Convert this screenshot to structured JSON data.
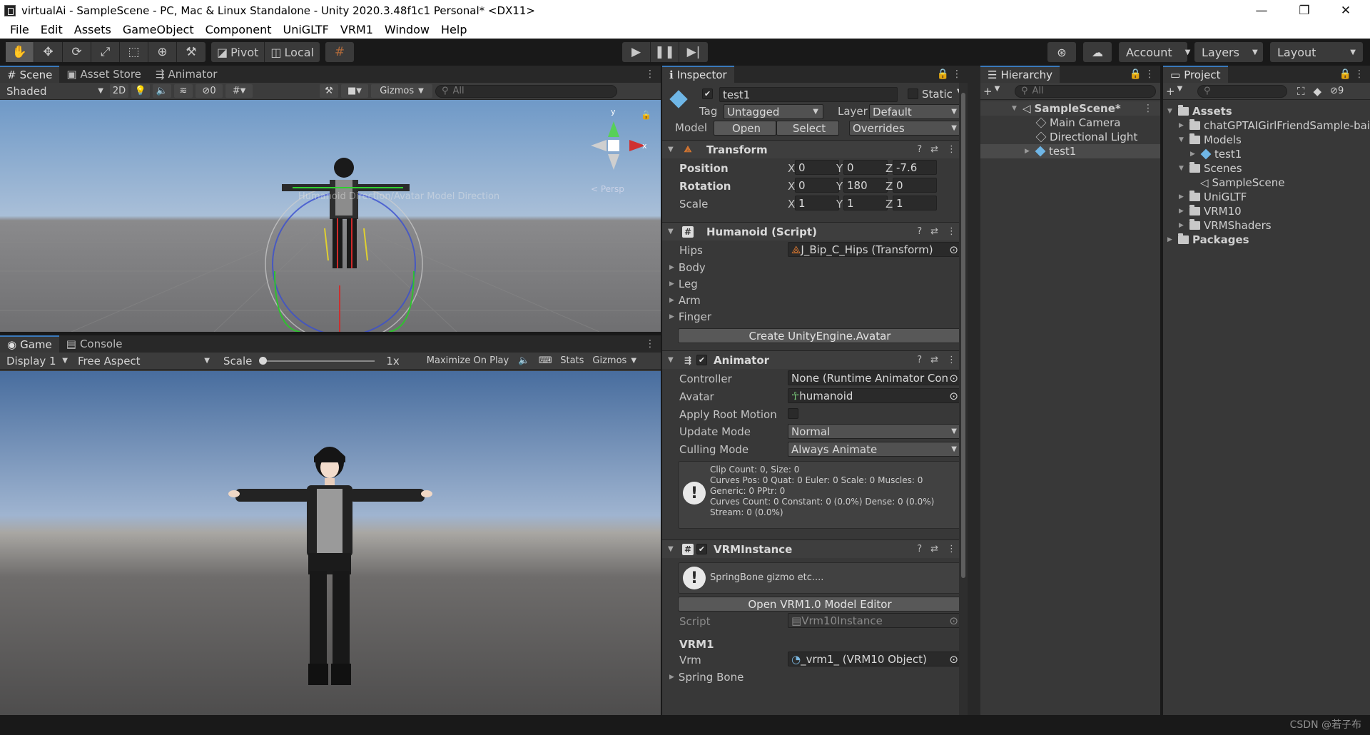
{
  "window": {
    "title": "virtualAi - SampleScene - PC, Mac & Linux Standalone - Unity 2020.3.48f1c1 Personal* <DX11>",
    "controls": [
      "—",
      "❐",
      "✕"
    ]
  },
  "menu": [
    "File",
    "Edit",
    "Assets",
    "GameObject",
    "Component",
    "UniGLTF",
    "VRM1",
    "Window",
    "Help"
  ],
  "toolbar": {
    "pivot": "Pivot",
    "local": "Local",
    "account": "Account",
    "layers": "Layers",
    "layout": "Layout"
  },
  "scene": {
    "tabs": [
      "Scene",
      "Asset Store",
      "Animator"
    ],
    "shading": "Shaded",
    "mode_2d": "2D",
    "hidden_count": "0",
    "gizmos": "Gizmos",
    "search_placeholder": "All",
    "persp": "< Persp",
    "overlay_text": "Humanoid Direction/Avatar Model Direction"
  },
  "game": {
    "tabs": [
      "Game",
      "Console"
    ],
    "display": "Display 1",
    "aspect": "Free Aspect",
    "scale_label": "Scale",
    "scale_value": "1x",
    "maximize": "Maximize On Play",
    "stats": "Stats",
    "gizmos": "Gizmos"
  },
  "inspector": {
    "tab": "Inspector",
    "object_name": "test1",
    "static_label": "Static",
    "tag_label": "Tag",
    "tag_value": "Untagged",
    "layer_label": "Layer",
    "layer_value": "Default",
    "model_label": "Model",
    "open_btn": "Open",
    "select_btn": "Select",
    "overrides": "Overrides",
    "transform": {
      "title": "Transform",
      "position_label": "Position",
      "rotation_label": "Rotation",
      "scale_label": "Scale",
      "position": {
        "x": "0",
        "y": "0",
        "z": "-7.6"
      },
      "rotation": {
        "x": "0",
        "y": "180",
        "z": "0"
      },
      "scale": {
        "x": "1",
        "y": "1",
        "z": "1"
      }
    },
    "humanoid": {
      "title": "Humanoid (Script)",
      "hips_label": "Hips",
      "hips_value": "J_Bip_C_Hips (Transform)",
      "folds": [
        "Body",
        "Leg",
        "Arm",
        "Finger"
      ],
      "create_btn": "Create UnityEngine.Avatar"
    },
    "animator": {
      "title": "Animator",
      "controller_label": "Controller",
      "controller_value": "None (Runtime Animator Contro",
      "avatar_label": "Avatar",
      "avatar_value": "humanoid",
      "root_motion_label": "Apply Root Motion",
      "update_label": "Update Mode",
      "update_value": "Normal",
      "culling_label": "Culling Mode",
      "culling_value": "Always Animate",
      "info_lines": [
        "Clip Count: 0, Size: 0",
        "Curves Pos: 0 Quat: 0 Euler: 0 Scale: 0 Muscles: 0",
        "Generic: 0 PPtr: 0",
        "Curves Count: 0 Constant: 0 (0.0%) Dense: 0 (0.0%)",
        "Stream: 0 (0.0%)"
      ]
    },
    "vrm": {
      "title": "VRMInstance",
      "help": "SpringBone gizmo etc....",
      "editor_btn": "Open VRM1.0 Model Editor",
      "script_label": "Script",
      "script_value": "Vrm10Instance",
      "section": "VRM1",
      "vrm_label": "Vrm",
      "vrm_value": "_vrm1_ (VRM10 Object)",
      "spring_bone": "Spring Bone"
    }
  },
  "hierarchy": {
    "tab": "Hierarchy",
    "search_placeholder": "All",
    "scene": "SampleScene*",
    "items": [
      "Main Camera",
      "Directional Light",
      "test1"
    ]
  },
  "project": {
    "tab": "Project",
    "hidden_count": "9",
    "assets": "Assets",
    "items": [
      "chatGPTAIGirlFriendSample-bai",
      "Models",
      "test1",
      "Scenes",
      "SampleScene",
      "UniGLTF",
      "VRM10",
      "VRMShaders"
    ],
    "packages": "Packages"
  },
  "watermark": "CSDN @若子布"
}
